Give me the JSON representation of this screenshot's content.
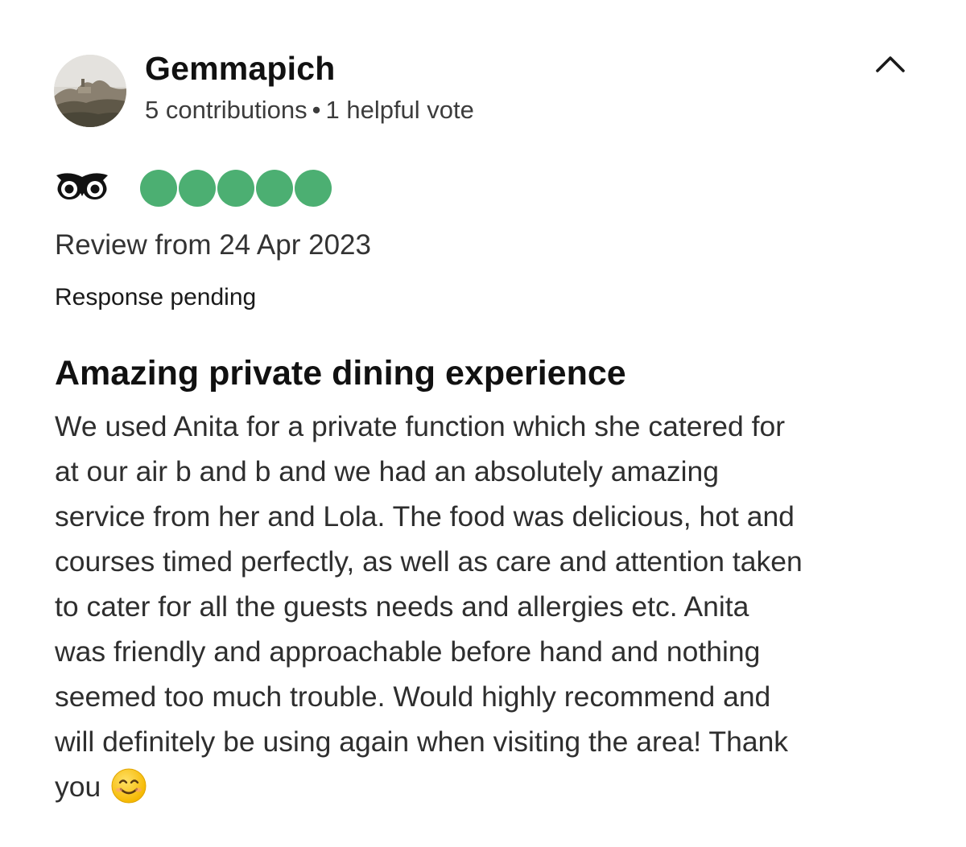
{
  "reviewer": {
    "username": "Gemmapich",
    "contributions": "5 contributions",
    "separator": "•",
    "helpful_votes": "1 helpful vote",
    "avatar_icon": "landscape-photo-avatar"
  },
  "header": {
    "collapse_icon": "chevron-up-icon"
  },
  "rating": {
    "provider_icon": "owl-logo-icon",
    "value": 5,
    "max": 5,
    "bubble_color": "#4CAF72"
  },
  "review": {
    "date": "Review from 24 Apr 2023",
    "response_status": "Response pending",
    "title": "Amazing private dining experience",
    "body_lines": [
      "We used Anita for a private function which she catered for",
      "at our air b and b and we had an absolutely amazing",
      "service from her and Lola. The food was delicious, hot and",
      "courses timed perfectly, as well as care and attention taken",
      "to cater for all the guests needs and allergies etc. Anita",
      "was friendly and approachable before hand and nothing",
      "seemed too much trouble. Would highly recommend and",
      "will definitely be using again when visiting the area! Thank",
      "you"
    ],
    "ending_emoji": "smiling-face-emoji"
  }
}
